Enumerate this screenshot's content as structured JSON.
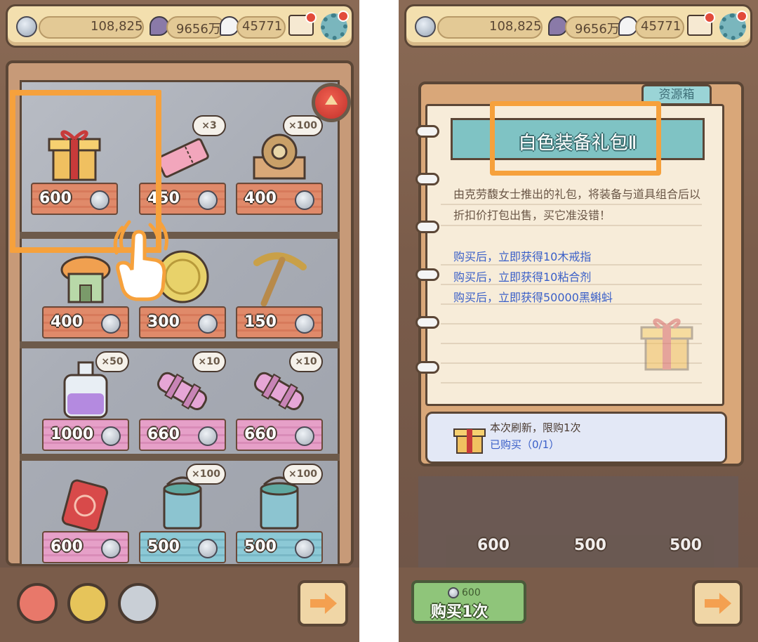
{
  "topbar": {
    "coins": "108,825",
    "purple_currency": "9656万",
    "white_currency": "45771"
  },
  "shop_items": [
    {
      "price": "600",
      "qty": ""
    },
    {
      "price": "450",
      "qty": "×3"
    },
    {
      "price": "400",
      "qty": "×100"
    },
    {
      "price": "400",
      "qty": ""
    },
    {
      "price": "300",
      "qty": ""
    },
    {
      "price": "150",
      "qty": ""
    },
    {
      "price": "1000",
      "qty": "×50"
    },
    {
      "price": "660",
      "qty": "×10"
    },
    {
      "price": "660",
      "qty": "×10"
    },
    {
      "price": "600",
      "qty": ""
    },
    {
      "price": "500",
      "qty": "×100"
    },
    {
      "price": "500",
      "qty": "×100"
    }
  ],
  "detail": {
    "tab": "资源箱",
    "title": "白色装备礼包Ⅱ",
    "description": "由克劳馥女士推出的礼包，将装备与道具组合后以折扣价打包出售，买它准没错！",
    "rewards": [
      "购买后，立即获得10木戒指",
      "购买后，立即获得10粘合剂",
      "购买后，立即获得50000黑蝌蚪"
    ],
    "limit_line": "本次刷新，限购1次",
    "purchased_line": "已购买（0/1）",
    "dim_prices": [
      "600",
      "500",
      "500"
    ]
  },
  "buy": {
    "cost": "600",
    "label": "购买1次"
  },
  "colors": {
    "highlight": "#f6a13c",
    "reward_text": "#3a5fc8",
    "buy_green": "#8fc57a"
  }
}
